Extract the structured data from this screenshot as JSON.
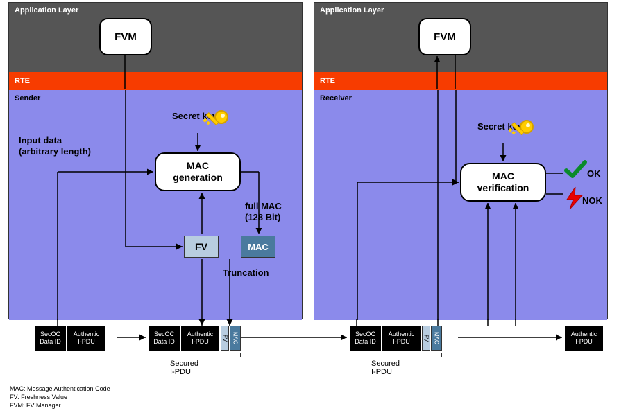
{
  "left": {
    "appLayer": "Application Layer",
    "fvm": "FVM",
    "rte": "RTE",
    "mainLabel": "Sender",
    "inputData": "Input data\n(arbitrary length)",
    "secretKey": "Secret key K",
    "macBox": "MAC\ngeneration",
    "fullMac": "full MAC\n(128 Bit)",
    "fv": "FV",
    "mac": "MAC",
    "truncation": "Truncation"
  },
  "right": {
    "appLayer": "Application Layer",
    "fvm": "FVM",
    "rte": "RTE",
    "mainLabel": "Receiver",
    "secretKey": "Secret key K",
    "macBox": "MAC\nverification",
    "ok": "OK",
    "nok": "NOK"
  },
  "pdu": {
    "secoc": "SecOC\nData ID",
    "auth": "Authentic\nI-PDU",
    "fv": "FV",
    "mac": "MAC",
    "secured": "Secured I-PDU"
  },
  "legend": {
    "l1": "MAC: Message Authentication Code",
    "l2": "FV: Freshness Value",
    "l3": "FVM: FV Manager"
  }
}
